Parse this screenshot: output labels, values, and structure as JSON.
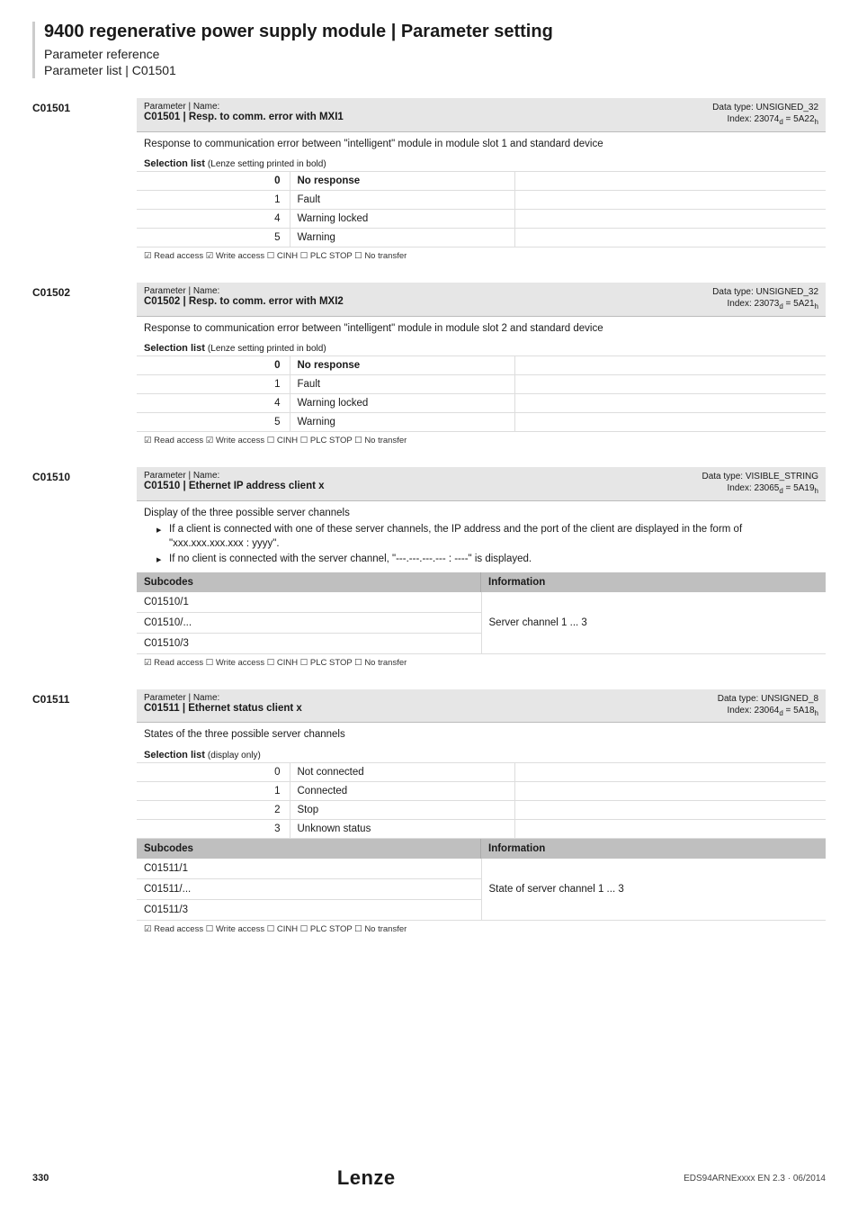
{
  "header": {
    "title": "9400 regenerative power supply module | Parameter setting",
    "subtitle1": "Parameter reference",
    "subtitle2": "Parameter list | C01501"
  },
  "params": [
    {
      "id": "C01501",
      "name_label": "Parameter | Name:",
      "name_main": "C01501 | Resp. to comm. error with MXI1",
      "dtype": "Data type: UNSIGNED_32",
      "index": "Index: 23074",
      "index_sub1": "d",
      "index_eq": " = 5A22",
      "index_sub2": "h",
      "desc": "Response to communication error between \"intelligent\" module in module slot 1 and standard device",
      "sel_title": "Selection list",
      "sel_hint": "(Lenze setting printed in bold)",
      "selections": [
        {
          "val": "0",
          "label": "No response",
          "bold": true
        },
        {
          "val": "1",
          "label": "Fault",
          "bold": false
        },
        {
          "val": "4",
          "label": "Warning locked",
          "bold": false
        },
        {
          "val": "5",
          "label": "Warning",
          "bold": false
        }
      ],
      "flags": "☑ Read access   ☑ Write access   ☐ CINH   ☐ PLC STOP   ☐ No transfer"
    },
    {
      "id": "C01502",
      "name_label": "Parameter | Name:",
      "name_main": "C01502 | Resp. to comm. error with MXI2",
      "dtype": "Data type: UNSIGNED_32",
      "index": "Index: 23073",
      "index_sub1": "d",
      "index_eq": " = 5A21",
      "index_sub2": "h",
      "desc": "Response to communication error between \"intelligent\" module in module slot 2 and standard device",
      "sel_title": "Selection list",
      "sel_hint": "(Lenze setting printed in bold)",
      "selections": [
        {
          "val": "0",
          "label": "No response",
          "bold": true
        },
        {
          "val": "1",
          "label": "Fault",
          "bold": false
        },
        {
          "val": "4",
          "label": "Warning locked",
          "bold": false
        },
        {
          "val": "5",
          "label": "Warning",
          "bold": false
        }
      ],
      "flags": "☑ Read access   ☑ Write access   ☐ CINH   ☐ PLC STOP   ☐ No transfer"
    },
    {
      "id": "C01510",
      "name_label": "Parameter | Name:",
      "name_main": "C01510 | Ethernet IP address client x",
      "dtype": "Data type: VISIBLE_STRING",
      "index": "Index: 23065",
      "index_sub1": "d",
      "index_eq": " = 5A19",
      "index_sub2": "h",
      "desc_text": "Display of the three possible server channels",
      "desc_bullets": [
        "If a client is connected with one of these server channels, the IP address and the port of the client are displayed in the form of \"xxx.xxx.xxx.xxx : yyyy\".",
        "If no client is connected with the server channel, \"---.---.---.--- : ----\" is displayed."
      ],
      "sub_header_c1": "Subcodes",
      "sub_header_c2": "Information",
      "subcodes": [
        "C01510/1",
        "C01510/...",
        "C01510/3"
      ],
      "info": "Server channel 1 ... 3",
      "flags": "☑ Read access   ☐ Write access   ☐ CINH   ☐ PLC STOP   ☐ No transfer"
    },
    {
      "id": "C01511",
      "name_label": "Parameter | Name:",
      "name_main": "C01511 | Ethernet status client x",
      "dtype": "Data type: UNSIGNED_8",
      "index": "Index: 23064",
      "index_sub1": "d",
      "index_eq": " = 5A18",
      "index_sub2": "h",
      "desc": "States of the three possible server channels",
      "sel_title": "Selection list",
      "sel_hint": "(display only)",
      "selections": [
        {
          "val": "0",
          "label": "Not connected",
          "bold": false
        },
        {
          "val": "1",
          "label": "Connected",
          "bold": false
        },
        {
          "val": "2",
          "label": "Stop",
          "bold": false
        },
        {
          "val": "3",
          "label": "Unknown status",
          "bold": false
        }
      ],
      "sub_header_c1": "Subcodes",
      "sub_header_c2": "Information",
      "subcodes": [
        "C01511/1",
        "C01511/...",
        "C01511/3"
      ],
      "info": "State of server channel 1 ... 3",
      "flags": "☑ Read access   ☐ Write access   ☐ CINH   ☐ PLC STOP   ☐ No transfer"
    }
  ],
  "footer": {
    "page": "330",
    "logo": "Lenze",
    "doc": "EDS94ARNExxxx EN 2.3 · 06/2014"
  }
}
